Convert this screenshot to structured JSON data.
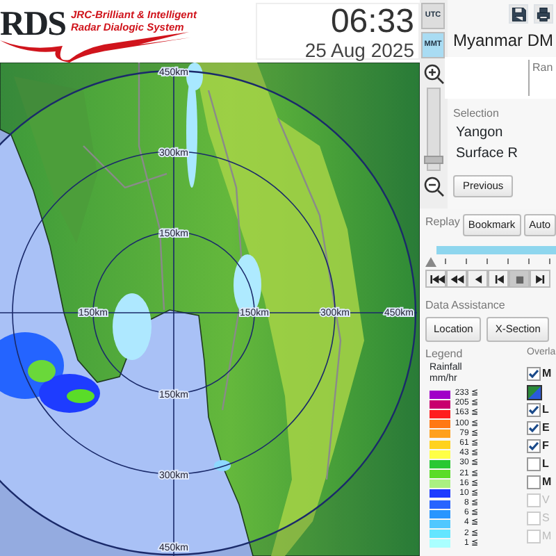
{
  "header": {
    "logo_mark": "RDS",
    "logo_line_1": "JRC-Brilliant & Intelligent",
    "logo_line_2": "Radar Dialogic System",
    "time": "06:33",
    "date": "25 Aug 2025"
  },
  "time_zones": [
    {
      "label": "UTC",
      "selected": false
    },
    {
      "label": "MMT",
      "selected": true
    }
  ],
  "map": {
    "north_labels": [
      "450km",
      "300km",
      "150km"
    ],
    "south_labels": [
      "150km",
      "300km",
      "450km"
    ],
    "west_labels": [
      "150km"
    ],
    "east_labels": [
      "150km",
      "300km",
      "450km"
    ],
    "zoom": {
      "level": 0.12
    }
  },
  "panel": {
    "title": "Myanmar DM",
    "partial_label": "Ran",
    "selection_label": "Selection",
    "selection": [
      "Yangon",
      "Surface R"
    ],
    "previous_button": "Previous"
  },
  "replay": {
    "label": "Replay",
    "buttons": [
      "Bookmark",
      "Auto"
    ],
    "timeline": {
      "level": 1
    },
    "controls": [
      {
        "kind": "first",
        "selected": false
      },
      {
        "kind": "fast-back",
        "selected": false
      },
      {
        "kind": "back",
        "selected": false
      },
      {
        "kind": "step-back",
        "selected": false
      },
      {
        "kind": "stop",
        "selected": true
      },
      {
        "kind": "step-forward",
        "selected": false
      }
    ]
  },
  "data_assistance": {
    "label": "Data Assistance",
    "buttons": [
      "Location",
      "X-Section"
    ]
  },
  "legend": {
    "title": "Legend",
    "unit_1": "Rainfall",
    "unit_2": "mm/hr",
    "entries": [
      {
        "label": "233 ≦",
        "color": "#a000c8"
      },
      {
        "label": "205 ≦",
        "color": "#c8006e"
      },
      {
        "label": "163 ≦",
        "color": "#ff1e1e"
      },
      {
        "label": "100 ≦",
        "color": "#ff7814"
      },
      {
        "label": "79 ≦",
        "color": "#ffa01e"
      },
      {
        "label": "61 ≦",
        "color": "#ffd21e"
      },
      {
        "label": "43 ≦",
        "color": "#ffff46"
      },
      {
        "label": "30 ≦",
        "color": "#28c832"
      },
      {
        "label": "21 ≦",
        "color": "#5adc28"
      },
      {
        "label": "16 ≦",
        "color": "#aaf082"
      },
      {
        "label": "10 ≦",
        "color": "#1e3cff"
      },
      {
        "label": "8 ≦",
        "color": "#2864ff"
      },
      {
        "label": "6 ≦",
        "color": "#2896ff"
      },
      {
        "label": "4 ≦",
        "color": "#50c8ff"
      },
      {
        "label": "2 ≦",
        "color": "#64e6ff"
      },
      {
        "label": "1 ≦",
        "color": "#aaffff"
      }
    ]
  },
  "overlays": {
    "title": "Overla",
    "items": [
      {
        "kind": "checkbox",
        "label": "M",
        "checked": true,
        "disabled": false
      },
      {
        "kind": "swatch"
      },
      {
        "kind": "checkbox",
        "label": "L",
        "checked": true,
        "disabled": false
      },
      {
        "kind": "checkbox",
        "label": "E",
        "checked": true,
        "disabled": false
      },
      {
        "kind": "checkbox",
        "label": "F",
        "checked": true,
        "disabled": false
      },
      {
        "kind": "checkbox",
        "label": "L",
        "checked": false,
        "disabled": false
      },
      {
        "kind": "checkbox",
        "label": "M",
        "checked": false,
        "disabled": false
      },
      {
        "kind": "checkbox",
        "label": "V",
        "checked": false,
        "disabled": true
      },
      {
        "kind": "checkbox",
        "label": "S",
        "checked": false,
        "disabled": true
      },
      {
        "kind": "checkbox",
        "label": "M",
        "checked": false,
        "disabled": true
      }
    ]
  }
}
